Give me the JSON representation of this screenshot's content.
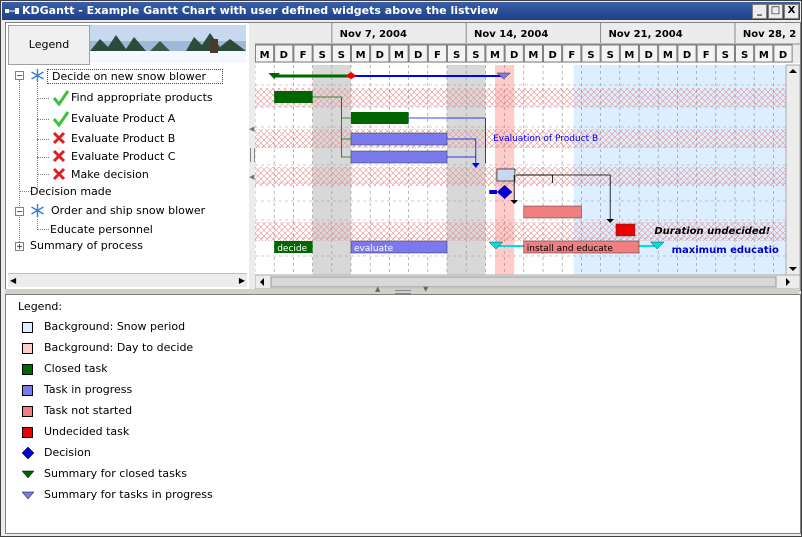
{
  "window": {
    "title": "KDGantt - Example Gantt Chart with user defined widgets above the listview",
    "buttons": [
      "_",
      "□",
      "X"
    ]
  },
  "listview": {
    "legend_button": "Legend",
    "rows": [
      {
        "label": "Decide on new snow blower",
        "icon": "snowflake-icon"
      },
      {
        "label": "Find appropriate products",
        "icon": "checkmark-icon"
      },
      {
        "label": "Evaluate Product A",
        "icon": "checkmark-icon"
      },
      {
        "label": "Evaluate Product B",
        "icon": "cross-icon"
      },
      {
        "label": "Evaluate Product C",
        "icon": "cross-icon"
      },
      {
        "label": "Make decision",
        "icon": "cross-icon"
      },
      {
        "label": "Decision made",
        "icon": ""
      },
      {
        "label": "Order and ship snow blower",
        "icon": "snowflake-icon"
      },
      {
        "label": "Educate personnel",
        "icon": ""
      },
      {
        "label": "Summary of process",
        "icon": ""
      }
    ]
  },
  "gantt": {
    "weeks": [
      "Nov 7, 2004",
      "Nov 14, 2004",
      "Nov 21, 2004",
      "Nov 28, 2"
    ],
    "days": [
      "M",
      "D",
      "F",
      "S",
      "S",
      "M",
      "D",
      "M",
      "D",
      "F",
      "S",
      "S",
      "M",
      "D",
      "M",
      "D",
      "F",
      "S",
      "S",
      "M",
      "D",
      "M",
      "D",
      "F",
      "S",
      "S",
      "M",
      "D"
    ],
    "annotations": {
      "eval_b": "Evaluation of Product B",
      "duration": "Duration undecided!",
      "max_edu": "maximum educatio"
    },
    "summary_labels": {
      "decide": "decide",
      "evaluate": "evaluate",
      "install": "install and educate"
    }
  },
  "legend": {
    "title": "Legend:",
    "items": [
      {
        "label": "Background: Snow period",
        "color": "#ddeeff",
        "shape": "square"
      },
      {
        "label": "Background: Day to decide",
        "color": "#ffcccc",
        "shape": "square"
      },
      {
        "label": "Closed task",
        "color": "#006600",
        "shape": "square"
      },
      {
        "label": "Task in progress",
        "color": "#7a7aee",
        "shape": "square"
      },
      {
        "label": "Task not started",
        "color": "#f08080",
        "shape": "square"
      },
      {
        "label": "Undecided task",
        "color": "#ee0000",
        "shape": "square"
      },
      {
        "label": "Decision",
        "color": "#0000cc",
        "shape": "diamond"
      },
      {
        "label": "Summary for closed tasks",
        "color": "#006600",
        "shape": "triangle"
      },
      {
        "label": "Summary for tasks in progress",
        "color": "#7a7aee",
        "shape": "triangle"
      }
    ]
  },
  "colors": {
    "snow": "#ddeeff",
    "decide_day": "#ffcccc",
    "weekend": "#d8d8d8",
    "closed": "#006600",
    "progress": "#7a7aee",
    "notstarted": "#f08080",
    "undecided": "#ee0000",
    "decision": "#0000cc",
    "link_blue": "#0000ff",
    "link_green": "#007700",
    "cyan": "#00e0e0"
  }
}
